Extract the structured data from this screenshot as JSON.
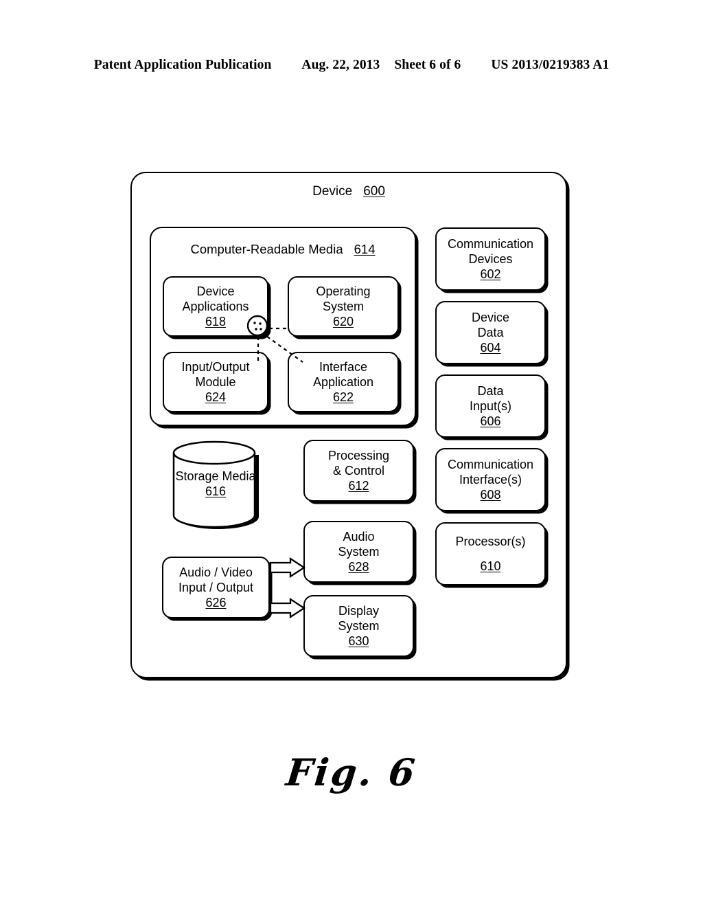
{
  "header": {
    "publication": "Patent Application Publication",
    "date": "Aug. 22, 2013",
    "sheet": "Sheet 6 of 6",
    "pub_number": "US 2013/0219383 A1"
  },
  "figure": {
    "caption": "Fig. 6",
    "device": {
      "label": "Device",
      "ref": "600"
    },
    "computer_readable_media": {
      "label": "Computer-Readable Media",
      "ref": "614"
    },
    "inner_blocks": [
      {
        "lines": [
          "Device",
          "Applications"
        ],
        "ref": "618",
        "name": "device-applications"
      },
      {
        "lines": [
          "Operating",
          "System"
        ],
        "ref": "620",
        "name": "operating-system"
      },
      {
        "lines": [
          "Input/Output",
          "Module"
        ],
        "ref": "624",
        "name": "input-output-module"
      },
      {
        "lines": [
          "Interface",
          "Application"
        ],
        "ref": "622",
        "name": "interface-application"
      }
    ],
    "storage_media": {
      "lines": [
        "Storage",
        "Media"
      ],
      "ref": "616",
      "name": "storage-media"
    },
    "middle_blocks": [
      {
        "lines": [
          "Processing",
          "& Control"
        ],
        "ref": "612",
        "name": "processing-and-control"
      },
      {
        "lines": [
          "Audio",
          "System"
        ],
        "ref": "628",
        "name": "audio-system"
      },
      {
        "lines": [
          "Display",
          "System"
        ],
        "ref": "630",
        "name": "display-system"
      }
    ],
    "av_io": {
      "lines": [
        "Audio / Video",
        "Input / Output"
      ],
      "ref": "626",
      "name": "audio-video-input-output"
    },
    "right_blocks": [
      {
        "lines": [
          "Communication",
          "Devices"
        ],
        "ref": "602",
        "name": "communication-devices"
      },
      {
        "lines": [
          "Device",
          "Data"
        ],
        "ref": "604",
        "name": "device-data"
      },
      {
        "lines": [
          "Data",
          "Input(s)"
        ],
        "ref": "606",
        "name": "data-inputs"
      },
      {
        "lines": [
          "Communication",
          "Interface(s)"
        ],
        "ref": "608",
        "name": "communication-interfaces"
      },
      {
        "lines": [
          "Processor(s)"
        ],
        "ref": "610",
        "name": "processors"
      }
    ],
    "colors": {
      "ink": "#000000",
      "paper": "#ffffff"
    }
  }
}
